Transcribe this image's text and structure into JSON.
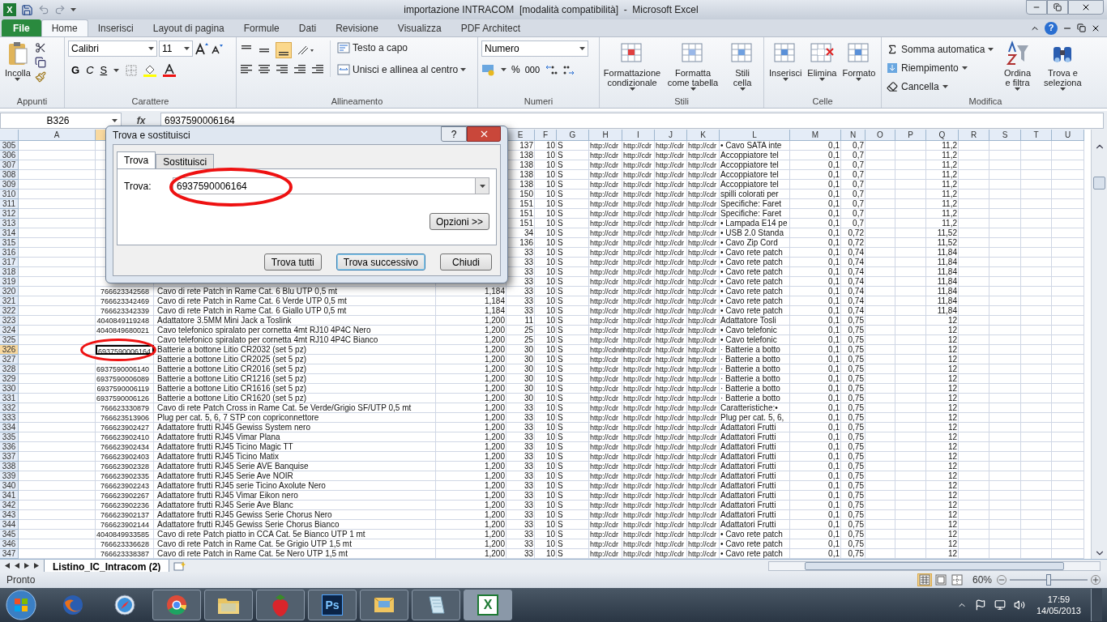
{
  "window": {
    "app_icon": "X",
    "title": "importazione INTRACOM  [modalità compatibilità]  -  Microsoft Excel"
  },
  "ribbon": {
    "tabs": [
      {
        "label": "File",
        "kind": "file",
        "selected": false
      },
      {
        "label": "Home",
        "kind": "tab",
        "selected": true
      },
      {
        "label": "Inserisci",
        "kind": "tab",
        "selected": false
      },
      {
        "label": "Layout di pagina",
        "kind": "tab",
        "selected": false
      },
      {
        "label": "Formule",
        "kind": "tab",
        "selected": false
      },
      {
        "label": "Dati",
        "kind": "tab",
        "selected": false
      },
      {
        "label": "Revisione",
        "kind": "tab",
        "selected": false
      },
      {
        "label": "Visualizza",
        "kind": "tab",
        "selected": false
      },
      {
        "label": "PDF Architect",
        "kind": "tab",
        "selected": false
      }
    ],
    "clipboard": {
      "label": "Appunti",
      "paste": "Incolla"
    },
    "font": {
      "label": "Carattere",
      "name": "Calibri",
      "size": "11",
      "bold": "G",
      "italic": "C",
      "underline": "S"
    },
    "alignment": {
      "label": "Allineamento",
      "wrap": "Testo a capo",
      "merge": "Unisci e allinea al centro"
    },
    "number": {
      "label": "Numeri",
      "format": "Numero",
      "percent": "%",
      "thousands": "000"
    },
    "styles": {
      "label": "Stili",
      "conditional": "Formattazione condizionale",
      "table": "Formatta come tabella",
      "cell": "Stili cella"
    },
    "cells": {
      "label": "Celle",
      "insert": "Inserisci",
      "delete": "Elimina",
      "format": "Formato"
    },
    "editing": {
      "label": "Modifica",
      "autosum": "Somma automatica",
      "fill": "Riempimento",
      "clear": "Cancella",
      "sort": "Ordina e filtra",
      "find": "Trova e seleziona"
    }
  },
  "formula_bar": {
    "name_box": "B326",
    "fx": "fx",
    "value": "6937590006164"
  },
  "sheet": {
    "columns": [
      {
        "letter": "A",
        "selected": false
      },
      {
        "selected": true
      },
      {},
      {},
      {
        "letter": "E",
        "selected": false
      },
      {
        "letter": "F",
        "selected": false
      },
      {
        "letter": "G",
        "selected": false
      },
      {
        "letter": "H",
        "selected": false
      },
      {
        "letter": "I",
        "selected": false
      },
      {
        "letter": "J",
        "selected": false
      },
      {
        "letter": "K",
        "selected": false
      },
      {
        "letter": "L",
        "selected": false
      },
      {
        "letter": "M",
        "selected": false
      },
      {
        "letter": "N",
        "selected": false
      },
      {
        "letter": "O",
        "selected": false
      },
      {
        "letter": "P",
        "selected": false
      },
      {
        "letter": "Q",
        "selected": false
      },
      {
        "letter": "R",
        "selected": false
      },
      {
        "letter": "S",
        "selected": false
      },
      {
        "letter": "T",
        "selected": false
      },
      {
        "letter": "U",
        "selected": false
      }
    ],
    "rows": [
      {
        "header": "305",
        "selected": false,
        "cells": [
          null,
          null,
          null,
          null,
          "137",
          "10",
          "S",
          "http://cdr",
          "http://cdr",
          "http://cdr",
          "http://cdr",
          "• Cavo SATA inte",
          "0,1",
          "0,7",
          null,
          null,
          "11,2",
          null,
          null,
          null,
          null
        ]
      },
      {
        "header": "306",
        "selected": false,
        "cells": [
          null,
          null,
          null,
          null,
          "138",
          "10",
          "S",
          "http://cdr",
          "http://cdr",
          "http://cdr",
          "http://cdr",
          "Accoppiatore tel",
          "0,1",
          "0,7",
          null,
          null,
          "11,2",
          null,
          null,
          null,
          null
        ]
      },
      {
        "header": "307",
        "selected": false,
        "cells": [
          null,
          null,
          null,
          null,
          "138",
          "10",
          "S",
          "http://cdr",
          "http://cdr",
          "http://cdr",
          "http://cdr",
          "Accoppiatore tel",
          "0,1",
          "0,7",
          null,
          null,
          "11,2",
          null,
          null,
          null,
          null
        ]
      },
      {
        "header": "308",
        "selected": false,
        "cells": [
          null,
          null,
          null,
          null,
          "138",
          "10",
          "S",
          "http://cdr",
          "http://cdr",
          "http://cdr",
          "http://cdr",
          "Accoppiatore tel",
          "0,1",
          "0,7",
          null,
          null,
          "11,2",
          null,
          null,
          null,
          null
        ]
      },
      {
        "header": "309",
        "selected": false,
        "cells": [
          null,
          null,
          null,
          null,
          "138",
          "10",
          "S",
          "http://cdr",
          "http://cdr",
          "http://cdr",
          "http://cdr",
          "Accoppiatore tel",
          "0,1",
          "0,7",
          null,
          null,
          "11,2",
          null,
          null,
          null,
          null
        ]
      },
      {
        "header": "310",
        "selected": false,
        "cells": [
          null,
          null,
          null,
          null,
          "150",
          "10",
          "S",
          "http://cdr",
          "http://cdr",
          "http://cdr",
          "http://cdr",
          "spilli colorati per",
          "0,1",
          "0,7",
          null,
          null,
          "11,2",
          null,
          null,
          null,
          null
        ]
      },
      {
        "header": "311",
        "selected": false,
        "cells": [
          null,
          null,
          null,
          null,
          "151",
          "10",
          "S",
          "http://cdr",
          "http://cdr",
          "http://cdr",
          "http://cdr",
          "Specifiche: Faret",
          "0,1",
          "0,7",
          null,
          null,
          "11,2",
          null,
          null,
          null,
          null
        ]
      },
      {
        "header": "312",
        "selected": false,
        "cells": [
          null,
          null,
          null,
          null,
          "151",
          "10",
          "S",
          "http://cdr",
          "http://cdr",
          "http://cdr",
          "http://cdr",
          "Specifiche: Faret",
          "0,1",
          "0,7",
          null,
          null,
          "11,2",
          null,
          null,
          null,
          null
        ]
      },
      {
        "header": "313",
        "selected": false,
        "cells": [
          null,
          null,
          null,
          null,
          "151",
          "10",
          "S",
          "http://cdr",
          "http://cdr",
          "http://cdr",
          "http://cdr",
          "• Lampada E14 pe",
          "0,1",
          "0,7",
          null,
          null,
          "11,2",
          null,
          null,
          null,
          null
        ]
      },
      {
        "header": "314",
        "selected": false,
        "cells": [
          null,
          null,
          null,
          null,
          "34",
          "10",
          "S",
          "http://cdr",
          "http://cdr",
          "http://cdr",
          "http://cdr",
          "• USB 2.0 Standa",
          "0,1",
          "0,72",
          null,
          null,
          "11,52",
          null,
          null,
          null,
          null
        ]
      },
      {
        "header": "315",
        "selected": false,
        "cells": [
          null,
          null,
          null,
          null,
          "136",
          "10",
          "S",
          "http://cdr",
          "http://cdr",
          "http://cdr",
          "http://cdr",
          "• Cavo Zip Cord",
          "0,1",
          "0,72",
          null,
          null,
          "11,52",
          null,
          null,
          null,
          null
        ]
      },
      {
        "header": "316",
        "selected": false,
        "cells": [
          null,
          null,
          null,
          null,
          "33",
          "10",
          "S",
          "http://cdr",
          "http://cdr",
          "http://cdr",
          "http://cdr",
          "• Cavo rete patch",
          "0,1",
          "0,74",
          null,
          null,
          "11,84",
          null,
          null,
          null,
          null
        ]
      },
      {
        "header": "317",
        "selected": false,
        "cells": [
          null,
          null,
          null,
          null,
          "33",
          "10",
          "S",
          "http://cdr",
          "http://cdr",
          "http://cdr",
          "http://cdr",
          "• Cavo rete patch",
          "0,1",
          "0,74",
          null,
          null,
          "11,84",
          null,
          null,
          null,
          null
        ]
      },
      {
        "header": "318",
        "selected": false,
        "cells": [
          null,
          null,
          null,
          null,
          "33",
          "10",
          "S",
          "http://cdr",
          "http://cdr",
          "http://cdr",
          "http://cdr",
          "• Cavo rete patch",
          "0,1",
          "0,74",
          null,
          null,
          "11,84",
          null,
          null,
          null,
          null
        ]
      },
      {
        "header": "319",
        "selected": false,
        "cells": [
          null,
          null,
          null,
          null,
          "33",
          "10",
          "S",
          "http://cdr",
          "http://cdr",
          "http://cdr",
          "http://cdr",
          "• Cavo rete patch",
          "0,1",
          "0,74",
          null,
          null,
          "11,84",
          null,
          null,
          null,
          null
        ]
      },
      {
        "header": "320",
        "selected": false,
        "cells": [
          null,
          "766623342568",
          "Cavo di rete Patch in Rame Cat. 6 Blu UTP 0,5 mt",
          "1,184",
          "33",
          "10",
          "S",
          "http://cdr",
          "http://cdr",
          "http://cdr",
          "http://cdr",
          "• Cavo rete patch",
          "0,1",
          "0,74",
          null,
          null,
          "11,84",
          null,
          null,
          null,
          null
        ]
      },
      {
        "header": "321",
        "selected": false,
        "cells": [
          null,
          "766623342469",
          "Cavo di rete Patch in Rame Cat. 6 Verde UTP 0,5 mt",
          "1,184",
          "33",
          "10",
          "S",
          "http://cdr",
          "http://cdr",
          "http://cdr",
          "http://cdr",
          "• Cavo rete patch",
          "0,1",
          "0,74",
          null,
          null,
          "11,84",
          null,
          null,
          null,
          null
        ]
      },
      {
        "header": "322",
        "selected": false,
        "cells": [
          null,
          "766623342339",
          "Cavo di rete Patch in Rame Cat. 6 Giallo UTP 0,5 mt",
          "1,184",
          "33",
          "10",
          "S",
          "http://cdr",
          "http://cdr",
          "http://cdr",
          "http://cdr",
          "• Cavo rete patch",
          "0,1",
          "0,74",
          null,
          null,
          "11,84",
          null,
          null,
          null,
          null
        ]
      },
      {
        "header": "323",
        "selected": false,
        "cells": [
          null,
          "4040849119248",
          "Adattatore 3.5MM Mini Jack a Toslink",
          "1,200",
          "11",
          "10",
          "S",
          "http://cdr",
          "http://cdr",
          "http://cdr",
          "http://cdr",
          "Adattatore Tosli",
          "0,1",
          "0,75",
          null,
          null,
          "12",
          null,
          null,
          null,
          null
        ]
      },
      {
        "header": "324",
        "selected": false,
        "cells": [
          null,
          "4040849680021",
          "Cavo telefonico spiralato per cornetta 4mt RJ10 4P4C Nero",
          "1,200",
          "25",
          "10",
          "S",
          "http://cdr",
          "http://cdr",
          "http://cdr",
          "http://cdr",
          "• Cavo telefonic",
          "0,1",
          "0,75",
          null,
          null,
          "12",
          null,
          null,
          null,
          null
        ]
      },
      {
        "header": "325",
        "selected": false,
        "cells": [
          null,
          null,
          "Cavo telefonico spiralato per cornetta 4mt RJ10 4P4C Bianco",
          "1,200",
          "25",
          "10",
          "S",
          "http://cdr",
          "http://cdr",
          "http://cdr",
          "http://cdr",
          "• Cavo telefonic",
          "0,1",
          "0,75",
          null,
          null,
          "12",
          null,
          null,
          null,
          null
        ]
      },
      {
        "header": "326",
        "selected": true,
        "cells": [
          null,
          "6937590006164",
          "Batterie a bottone Litio CR2032 (set 5 pz)",
          "1,200",
          "30",
          "10",
          "S",
          "http://cdnn",
          "http://cdr",
          "http://cdr",
          "http://cdr",
          "· Batterie a botto",
          "0,1",
          "0,75",
          null,
          null,
          "12",
          null,
          null,
          null,
          null
        ]
      },
      {
        "header": "327",
        "selected": false,
        "cells": [
          null,
          null,
          "Batterie a bottone Litio CR2025 (set 5 pz)",
          "1,200",
          "30",
          "10",
          "S",
          "http://cdr",
          "http://cdr",
          "http://cdr",
          "http://cdr",
          "· Batterie a botto",
          "0,1",
          "0,75",
          null,
          null,
          "12",
          null,
          null,
          null,
          null
        ]
      },
      {
        "header": "328",
        "selected": false,
        "cells": [
          null,
          "6937590006140",
          "Batterie a bottone Litio CR2016 (set 5 pz)",
          "1,200",
          "30",
          "10",
          "S",
          "http://cdr",
          "http://cdr",
          "http://cdr",
          "http://cdr",
          "· Batterie a botto",
          "0,1",
          "0,75",
          null,
          null,
          "12",
          null,
          null,
          null,
          null
        ]
      },
      {
        "header": "329",
        "selected": false,
        "cells": [
          null,
          "6937590006089",
          "Batterie a bottone Litio CR1216 (set 5 pz)",
          "1,200",
          "30",
          "10",
          "S",
          "http://cdr",
          "http://cdr",
          "http://cdr",
          "http://cdr",
          "· Batterie a botto",
          "0,1",
          "0,75",
          null,
          null,
          "12",
          null,
          null,
          null,
          null
        ]
      },
      {
        "header": "330",
        "selected": false,
        "cells": [
          null,
          "6937590006119",
          "Batterie a bottone Litio CR1616 (set 5 pz)",
          "1,200",
          "30",
          "10",
          "S",
          "http://cdr",
          "http://cdr",
          "http://cdr",
          "http://cdr",
          "· Batterie a botto",
          "0,1",
          "0,75",
          null,
          null,
          "12",
          null,
          null,
          null,
          null
        ]
      },
      {
        "header": "331",
        "selected": false,
        "cells": [
          null,
          "6937590006126",
          "Batterie a bottone Litio CR1620 (set 5 pz)",
          "1,200",
          "30",
          "10",
          "S",
          "http://cdr",
          "http://cdr",
          "http://cdr",
          "http://cdr",
          "· Batterie a botto",
          "0,1",
          "0,75",
          null,
          null,
          "12",
          null,
          null,
          null,
          null
        ]
      },
      {
        "header": "332",
        "selected": false,
        "cells": [
          null,
          "766623330879",
          "Cavo di rete Patch Cross in Rame Cat. 5e Verde/Grigio SF/UTP 0,5 mt",
          "1,200",
          "33",
          "10",
          "S",
          "http://cdr",
          "http://cdr",
          "http://cdr",
          "http://cdr",
          "Caratteristiche:•",
          "0,1",
          "0,75",
          null,
          null,
          "12",
          null,
          null,
          null,
          null
        ]
      },
      {
        "header": "333",
        "selected": false,
        "cells": [
          null,
          "766623513906",
          "Plug per cat. 5, 6, 7 STP con copriconnettore",
          "1,200",
          "33",
          "10",
          "S",
          "http://cdr",
          "http://cdr",
          "http://cdr",
          "http://cdr",
          "Plug per cat. 5, 6,",
          "0,1",
          "0,75",
          null,
          null,
          "12",
          null,
          null,
          null,
          null
        ]
      },
      {
        "header": "334",
        "selected": false,
        "cells": [
          null,
          "766623902427",
          "Adattatore frutti RJ45 Gewiss System nero",
          "1,200",
          "33",
          "10",
          "S",
          "http://cdr",
          "http://cdr",
          "http://cdr",
          "http://cdr",
          "Adattatori Frutti",
          "0,1",
          "0,75",
          null,
          null,
          "12",
          null,
          null,
          null,
          null
        ]
      },
      {
        "header": "335",
        "selected": false,
        "cells": [
          null,
          "766623902410",
          "Adattatore frutti RJ45 Vimar Plana",
          "1,200",
          "33",
          "10",
          "S",
          "http://cdr",
          "http://cdr",
          "http://cdr",
          "http://cdr",
          "Adattatori Frutti",
          "0,1",
          "0,75",
          null,
          null,
          "12",
          null,
          null,
          null,
          null
        ]
      },
      {
        "header": "336",
        "selected": false,
        "cells": [
          null,
          "766623902434",
          "Adattatore frutti RJ45 Ticino Magic TT",
          "1,200",
          "33",
          "10",
          "S",
          "http://cdr",
          "http://cdr",
          "http://cdr",
          "http://cdr",
          "Adattatori Frutti",
          "0,1",
          "0,75",
          null,
          null,
          "12",
          null,
          null,
          null,
          null
        ]
      },
      {
        "header": "337",
        "selected": false,
        "cells": [
          null,
          "766623902403",
          "Adattatore frutti RJ45 Ticino Matix",
          "1,200",
          "33",
          "10",
          "S",
          "http://cdr",
          "http://cdr",
          "http://cdr",
          "http://cdr",
          "Adattatori Frutti",
          "0,1",
          "0,75",
          null,
          null,
          "12",
          null,
          null,
          null,
          null
        ]
      },
      {
        "header": "338",
        "selected": false,
        "cells": [
          null,
          "766623902328",
          "Adattatore frutti RJ45 Serie AVE Banquise",
          "1,200",
          "33",
          "10",
          "S",
          "http://cdr",
          "http://cdr",
          "http://cdr",
          "http://cdr",
          "Adattatori Frutti",
          "0,1",
          "0,75",
          null,
          null,
          "12",
          null,
          null,
          null,
          null
        ]
      },
      {
        "header": "339",
        "selected": false,
        "cells": [
          null,
          "766623902335",
          "Adattatore frutti RJ45 Serie Ave NOIR",
          "1,200",
          "33",
          "10",
          "S",
          "http://cdr",
          "http://cdr",
          "http://cdr",
          "http://cdr",
          "Adattatori Frutti",
          "0,1",
          "0,75",
          null,
          null,
          "12",
          null,
          null,
          null,
          null
        ]
      },
      {
        "header": "340",
        "selected": false,
        "cells": [
          null,
          "766623902243",
          "Adattatore frutti RJ45 serie Ticino Axolute Nero",
          "1,200",
          "33",
          "10",
          "S",
          "http://cdr",
          "http://cdr",
          "http://cdr",
          "http://cdr",
          "Adattatori Frutti",
          "0,1",
          "0,75",
          null,
          null,
          "12",
          null,
          null,
          null,
          null
        ]
      },
      {
        "header": "341",
        "selected": false,
        "cells": [
          null,
          "766623902267",
          "Adattatore frutti RJ45 Vimar Eikon nero",
          "1,200",
          "33",
          "10",
          "S",
          "http://cdr",
          "http://cdr",
          "http://cdr",
          "http://cdr",
          "Adattatori Frutti",
          "0,1",
          "0,75",
          null,
          null,
          "12",
          null,
          null,
          null,
          null
        ]
      },
      {
        "header": "342",
        "selected": false,
        "cells": [
          null,
          "766623902236",
          "Adattatore frutti RJ45 Serie Ave Blanc",
          "1,200",
          "33",
          "10",
          "S",
          "http://cdr",
          "http://cdr",
          "http://cdr",
          "http://cdr",
          "Adattatori Frutti",
          "0,1",
          "0,75",
          null,
          null,
          "12",
          null,
          null,
          null,
          null
        ]
      },
      {
        "header": "343",
        "selected": false,
        "cells": [
          null,
          "766623902137",
          "Adattatore frutti RJ45 Gewiss Serie Chorus Nero",
          "1,200",
          "33",
          "10",
          "S",
          "http://cdr",
          "http://cdr",
          "http://cdr",
          "http://cdr",
          "Adattatori Frutti",
          "0,1",
          "0,75",
          null,
          null,
          "12",
          null,
          null,
          null,
          null
        ]
      },
      {
        "header": "344",
        "selected": false,
        "cells": [
          null,
          "766623902144",
          "Adattatore frutti RJ45 Gewiss Serie Chorus Bianco",
          "1,200",
          "33",
          "10",
          "S",
          "http://cdr",
          "http://cdr",
          "http://cdr",
          "http://cdr",
          "Adattatori Frutti",
          "0,1",
          "0,75",
          null,
          null,
          "12",
          null,
          null,
          null,
          null
        ]
      },
      {
        "header": "345",
        "selected": false,
        "cells": [
          null,
          "4040849933585",
          "Cavo di rete Patch piatto in CCA Cat. 5e Bianco UTP 1 mt",
          "1,200",
          "33",
          "10",
          "S",
          "http://cdr",
          "http://cdr",
          "http://cdr",
          "http://cdr",
          "• Cavo rete patch",
          "0,1",
          "0,75",
          null,
          null,
          "12",
          null,
          null,
          null,
          null
        ]
      },
      {
        "header": "346",
        "selected": false,
        "cells": [
          null,
          "766623336628",
          "Cavo di rete Patch in Rame Cat. 5e Grigio UTP 1,5 mt",
          "1,200",
          "33",
          "10",
          "S",
          "http://cdr",
          "http://cdr",
          "http://cdr",
          "http://cdr",
          "• Cavo rete patch",
          "0,1",
          "0,75",
          null,
          null,
          "12",
          null,
          null,
          null,
          null
        ]
      },
      {
        "header": "347",
        "selected": false,
        "cells": [
          null,
          "766623338387",
          "Cavo di rete Patch in Rame Cat. 5e Nero UTP 1,5 mt",
          "1,200",
          "33",
          "10",
          "S",
          "http://cdr",
          "http://cdr",
          "http://cdr",
          "http://cdr",
          "• Cavo rete patch",
          "0,1",
          "0,75",
          null,
          null,
          "12",
          null,
          null,
          null,
          null
        ]
      }
    ],
    "tabs": [
      {
        "label": "Listino_IC_Intracom (2)",
        "selected": true
      }
    ]
  },
  "dialog": {
    "title": "Trova e sostituisci",
    "help": "?",
    "tabs": [
      {
        "label": "Trova",
        "selected": true
      },
      {
        "label": "Sostituisci",
        "selected": false
      }
    ],
    "find_label": "Trova:",
    "find_value": "6937590006164",
    "options": "Opzioni >>",
    "buttons": [
      {
        "label": "Trova tutti",
        "selected": false
      },
      {
        "label": "Trova successivo",
        "selected": true
      },
      {
        "label": "Chiudi",
        "selected": false
      }
    ]
  },
  "status_bar": {
    "label": "Pronto",
    "views": [
      {
        "kind": "normal",
        "selected": true
      },
      {
        "kind": "layout",
        "selected": false
      },
      {
        "kind": "pagebreak",
        "selected": false
      }
    ],
    "zoom": "60%",
    "zoom_slider": {
      "level": 0.5
    }
  },
  "taskbar": {
    "apps": [
      {
        "kind": "firefox",
        "running": false,
        "selected": false
      },
      {
        "kind": "compass",
        "running": false,
        "selected": false
      },
      {
        "kind": "chrome",
        "running": true,
        "selected": false
      },
      {
        "kind": "folder",
        "running": true,
        "selected": false
      },
      {
        "kind": "strawberry",
        "running": true,
        "selected": false
      },
      {
        "kind": "photoshop",
        "label": "Ps",
        "running": true,
        "selected": false
      },
      {
        "kind": "mail",
        "running": true,
        "selected": false
      },
      {
        "kind": "notes",
        "running": true,
        "selected": false
      },
      {
        "kind": "excel",
        "label": "X",
        "running": true,
        "selected": true
      }
    ],
    "time": "17:59",
    "date": "14/05/2013"
  }
}
